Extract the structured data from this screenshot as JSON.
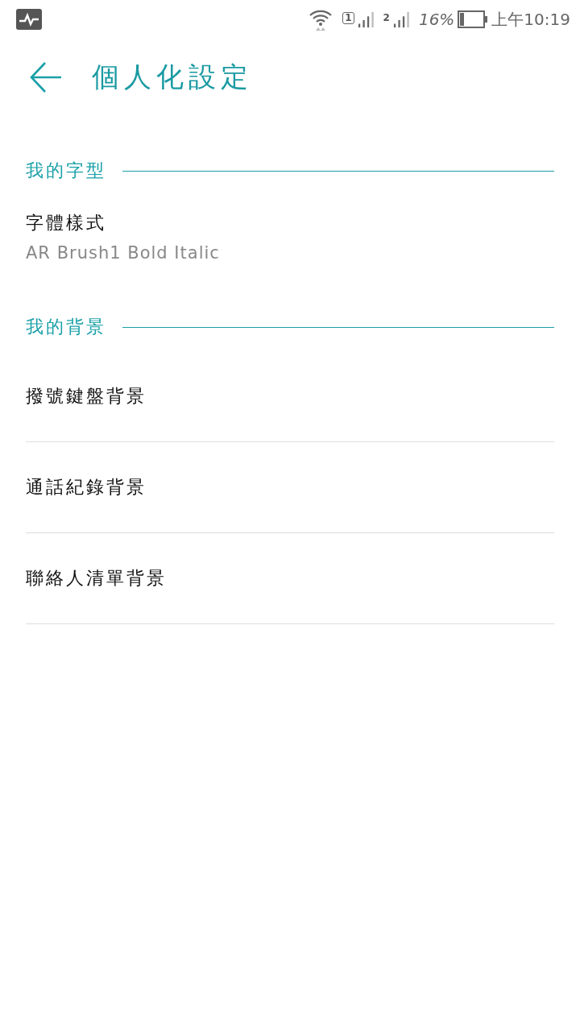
{
  "status_bar": {
    "sim_1": "1",
    "sim_2": "2",
    "battery": "16%",
    "time": "上午10:19"
  },
  "header": {
    "title": "個人化設定"
  },
  "sections": [
    {
      "title": "我的字型",
      "items": [
        {
          "label": "字體樣式",
          "value": "AR Brush1 Bold Italic"
        }
      ]
    },
    {
      "title": "我的背景",
      "items": [
        {
          "label": "撥號鍵盤背景"
        },
        {
          "label": "通話紀錄背景"
        },
        {
          "label": "聯絡人清單背景"
        }
      ]
    }
  ]
}
